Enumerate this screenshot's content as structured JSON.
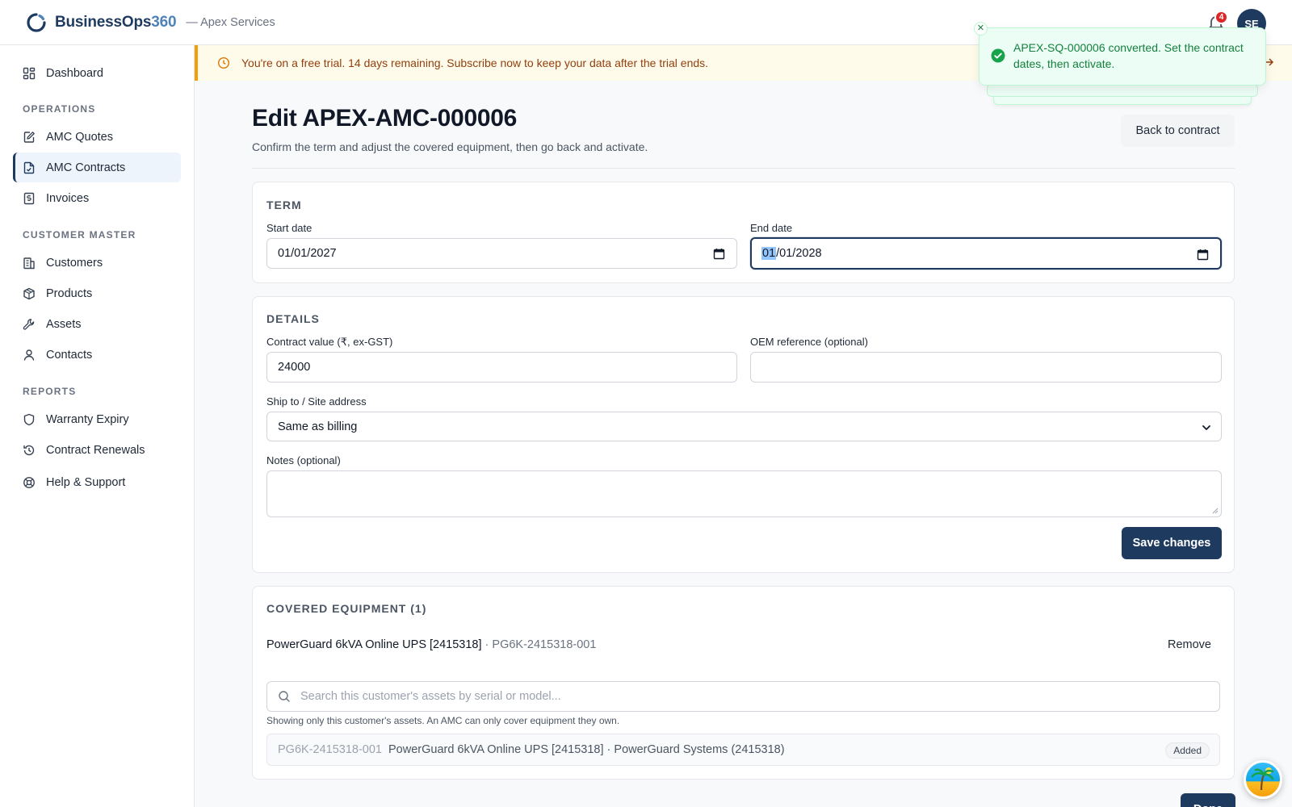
{
  "app": {
    "brand_prefix": "BusinessOps",
    "brand_suffix": "360",
    "org": "— Apex Services",
    "notification_count": "4",
    "user_initials": "SE"
  },
  "sidebar": {
    "dashboard": "Dashboard",
    "sections": {
      "operations": "OPERATIONS",
      "customer_master": "CUSTOMER MASTER",
      "reports": "REPORTS"
    },
    "items": {
      "amc_quotes": "AMC Quotes",
      "amc_contracts": "AMC Contracts",
      "invoices": "Invoices",
      "customers": "Customers",
      "products": "Products",
      "assets": "Assets",
      "contacts": "Contacts",
      "warranty_expiry": "Warranty Expiry",
      "contract_renewals": "Contract Renewals",
      "help_support": "Help & Support"
    },
    "active": "amc_contracts"
  },
  "banner": {
    "text": "You're on a free trial. 14 days remaining. Subscribe now to keep your data after the trial ends."
  },
  "toast": {
    "message": "APEX-SQ-000006 converted. Set the contract dates, then activate."
  },
  "page": {
    "title": "Edit APEX-AMC-000006",
    "subtitle": "Confirm the term and adjust the covered equipment, then go back and activate.",
    "back_button": "Back to contract"
  },
  "term": {
    "heading": "TERM",
    "start_label": "Start date",
    "start_value": "01/01/2027",
    "end_label": "End date",
    "end_value_selected": "01",
    "end_value_rest": "/01/2028"
  },
  "details": {
    "heading": "DETAILS",
    "value_label": "Contract value (₹, ex-GST)",
    "value": "24000",
    "oem_label": "OEM reference (optional)",
    "oem_value": "",
    "ship_label": "Ship to / Site address",
    "ship_value": "Same as billing",
    "notes_label": "Notes (optional)",
    "notes_value": "",
    "save_button": "Save changes"
  },
  "equipment": {
    "heading": "COVERED EQUIPMENT (1)",
    "items": [
      {
        "name": "PowerGuard 6kVA Online UPS [2415318]",
        "serial": " · PG6K-2415318-001",
        "remove": "Remove"
      }
    ],
    "search_placeholder": "Search this customer's assets by serial or model...",
    "hint": "Showing only this customer's assets. An AMC can only cover equipment they own.",
    "results": [
      {
        "serial": "PG6K-2415318-001",
        "description": "PowerGuard 6kVA Online UPS [2415318] · PowerGuard Systems (2415318)",
        "badge": "Added"
      }
    ]
  },
  "footer": {
    "done_button": "Done"
  },
  "colors": {
    "primary": "#1e3a5f",
    "accent_blue": "#4f83b8",
    "success": "#15803d",
    "warning": "#f59e0b",
    "danger": "#dc2626"
  },
  "icons": {
    "dashboard": "grid-icon",
    "amc_quotes": "edit-doc-icon",
    "amc_contracts": "file-check-icon",
    "invoices": "receipt-icon",
    "customers": "building-icon",
    "products": "box-icon",
    "assets": "wrench-icon",
    "contacts": "user-icon",
    "warranty_expiry": "shield-icon",
    "contract_renewals": "history-icon",
    "help_support": "lifebuoy-icon"
  }
}
